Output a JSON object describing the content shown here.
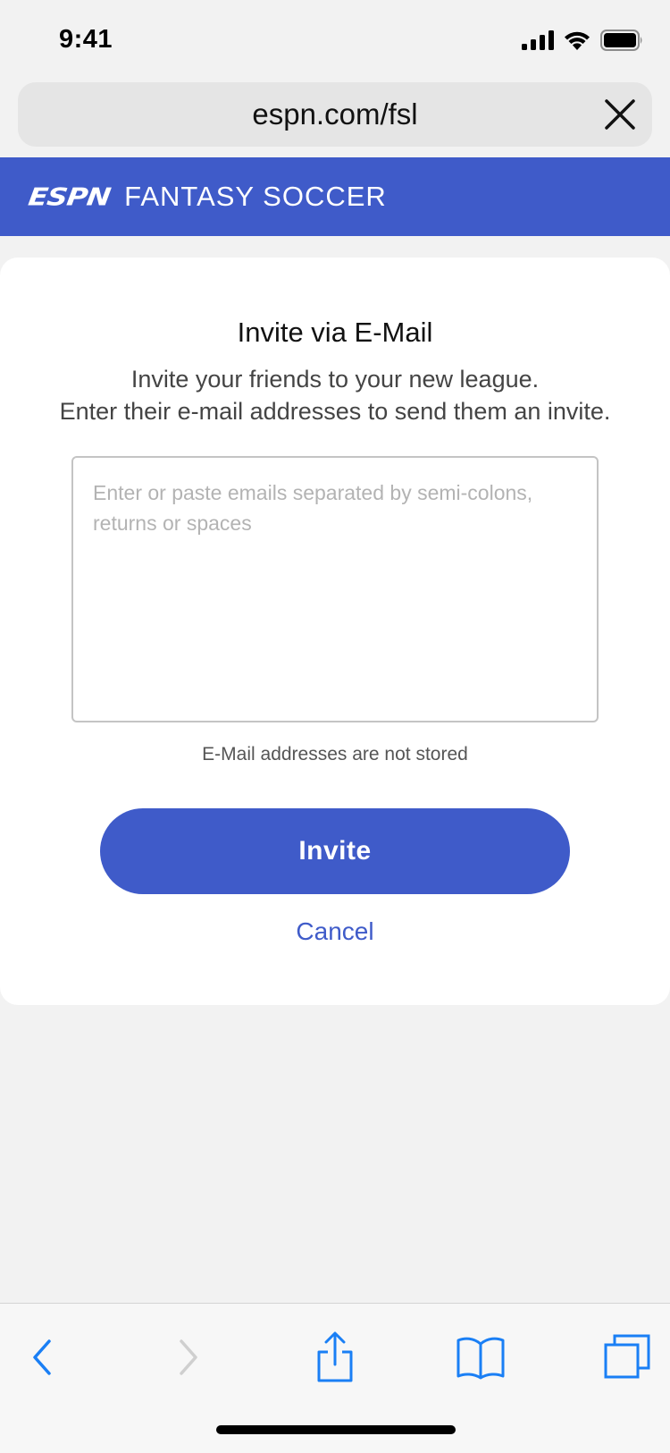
{
  "status_bar": {
    "time": "9:41",
    "icons": [
      "cellular-signal-icon",
      "wifi-icon",
      "battery-icon"
    ]
  },
  "browser": {
    "url": "espn.com/fsl",
    "close_icon": "close-icon"
  },
  "header": {
    "logo_text": "ESPN",
    "title": "FANTASY SOCCER",
    "background_color": "#3f5bc9"
  },
  "invite_card": {
    "title": "Invite via E-Mail",
    "description_line1": "Invite your friends to your new league.",
    "description_line2": "Enter their e-mail addresses to send them an invite.",
    "email_field": {
      "value": "",
      "placeholder": "Enter or paste emails separated by semi-colons, returns or spaces"
    },
    "helper_note": "E-Mail addresses are not stored",
    "invite_label": "Invite",
    "cancel_label": "Cancel",
    "accent_color": "#3f5bc9"
  },
  "toolbar": {
    "items": [
      "back-icon",
      "forward-icon",
      "share-icon",
      "bookmarks-icon",
      "tabs-icon"
    ]
  }
}
